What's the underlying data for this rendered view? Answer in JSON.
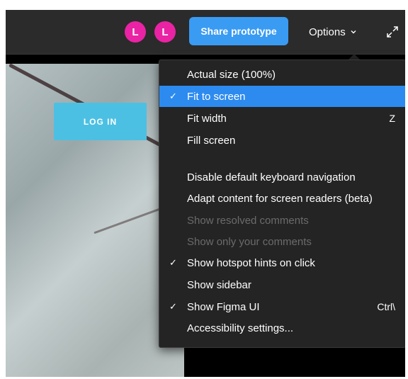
{
  "topbar": {
    "avatars": [
      "L",
      "L"
    ],
    "share_label": "Share prototype",
    "options_label": "Options",
    "icons": {
      "options_chevron": "chevron-down-icon",
      "expand": "expand-icon"
    }
  },
  "canvas": {
    "login_label": "LOG IN"
  },
  "menu": {
    "items": [
      {
        "label": "Actual size (100%)",
        "check": "",
        "shortcut": ""
      },
      {
        "label": "Fit to screen",
        "check": "✓",
        "shortcut": ""
      },
      {
        "label": "Fit width",
        "check": "",
        "shortcut": "Z"
      },
      {
        "label": "Fill screen",
        "check": "",
        "shortcut": ""
      },
      {
        "label": "Disable default keyboard navigation",
        "check": "",
        "shortcut": ""
      },
      {
        "label": "Adapt content for screen readers (beta)",
        "check": "",
        "shortcut": ""
      },
      {
        "label": "Show resolved comments",
        "check": "",
        "shortcut": ""
      },
      {
        "label": "Show only your comments",
        "check": "",
        "shortcut": ""
      },
      {
        "label": "Show hotspot hints on click",
        "check": "✓",
        "shortcut": ""
      },
      {
        "label": "Show sidebar",
        "check": "",
        "shortcut": ""
      },
      {
        "label": "Show Figma UI",
        "check": "✓",
        "shortcut": "Ctrl\\"
      },
      {
        "label": "Accessibility settings...",
        "check": "",
        "shortcut": ""
      }
    ]
  },
  "colors": {
    "accent": "#3a9bf2",
    "selected": "#2d8bf0",
    "avatar": "#e923a4",
    "login": "#4cc0e3"
  }
}
